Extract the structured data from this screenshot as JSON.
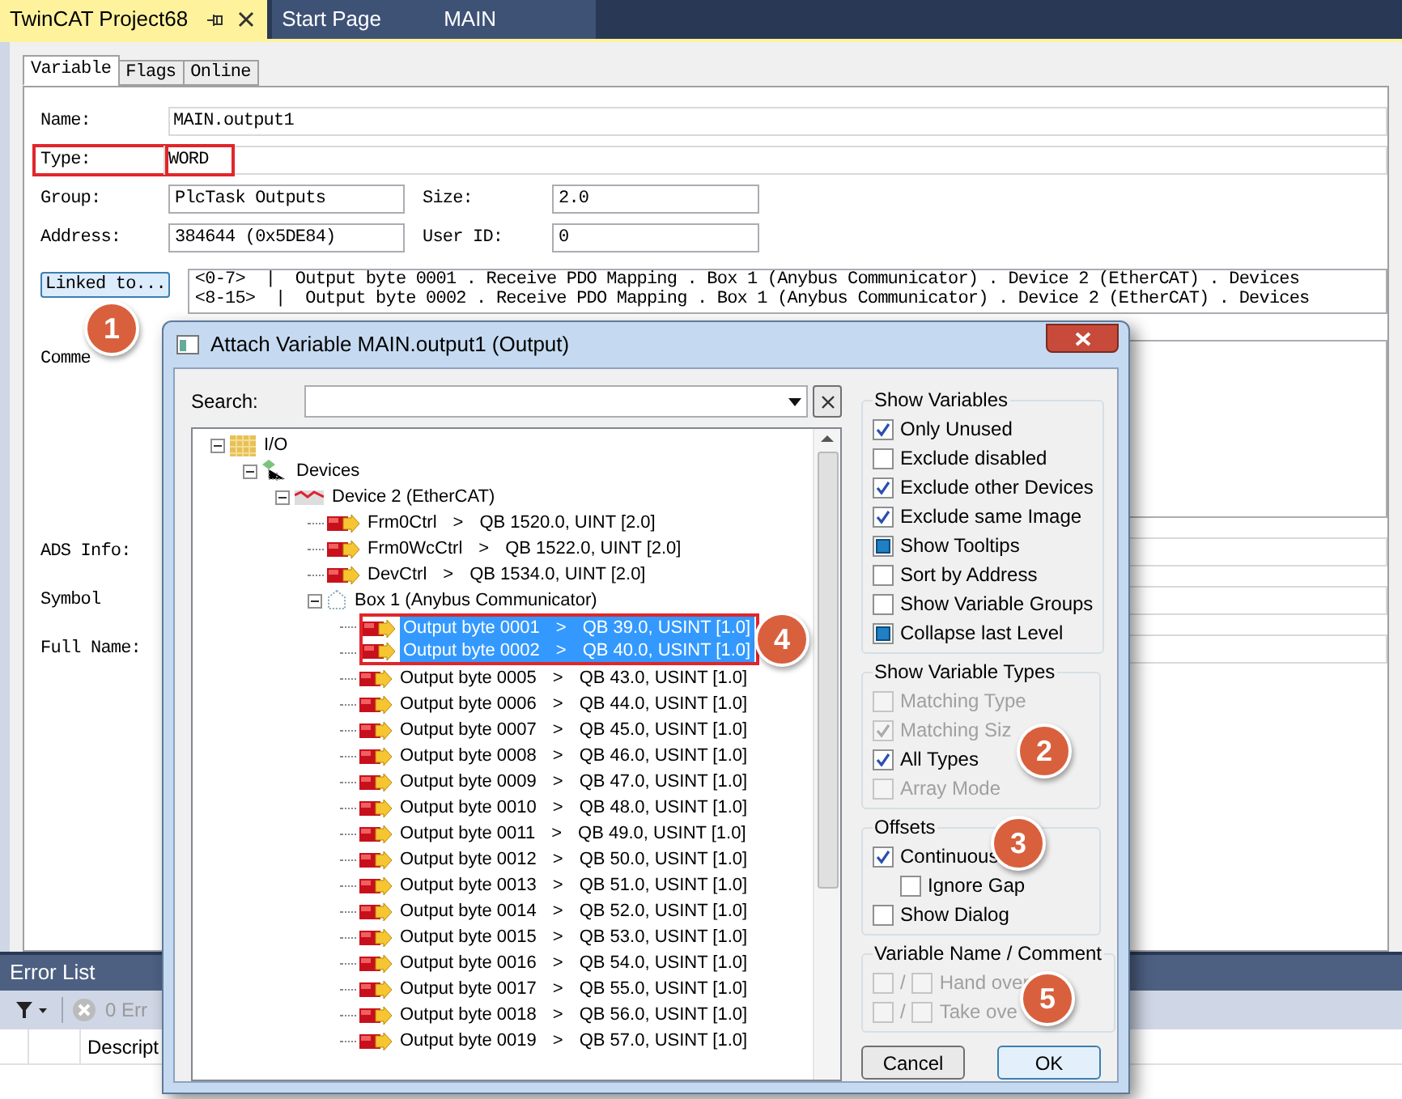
{
  "document_tabs": [
    {
      "label": "TwinCAT Project68",
      "selected": true
    },
    {
      "label": "Start Page",
      "selected": false
    },
    {
      "label": "MAIN",
      "selected": false
    }
  ],
  "property_tabs": [
    {
      "label": "Variable",
      "selected": true
    },
    {
      "label": "Flags",
      "selected": false
    },
    {
      "label": "Online",
      "selected": false
    }
  ],
  "form_rows": [
    [
      {
        "kind": "wide",
        "label": "Name:",
        "value": "MAIN.output1",
        "highlighted": false
      }
    ],
    [
      {
        "kind": "wide",
        "label": "Type:",
        "value": "WORD",
        "highlighted": true
      }
    ],
    [
      {
        "kind": "short",
        "label": "Group:",
        "value": "PlcTask Outputs",
        "highlighted": false
      },
      {
        "kind": "short",
        "label": "Size:",
        "value": "2.0",
        "highlighted": false
      }
    ],
    [
      {
        "kind": "short",
        "label": "Address:",
        "value": "384644 (0x5DE84)",
        "highlighted": false
      },
      {
        "kind": "short",
        "label": "User ID:",
        "value": "0",
        "highlighted": false
      }
    ],
    [
      {
        "kind": "link",
        "label": "Linked to...",
        "lines": [
          "<0-7>  |  Output byte 0001 . Receive PDO Mapping . Box 1 (Anybus Communicator) . Device 2 (EtherCAT) . Devices",
          "<8-15>  |  Output byte 0002 . Receive PDO Mapping . Box 1 (Anybus Communicator) . Device 2 (EtherCAT) . Devices"
        ],
        "highlighted": false
      }
    ],
    [
      {
        "kind": "area",
        "label": "Comme",
        "highlighted": false
      }
    ],
    [
      {
        "kind": "wide",
        "label": "ADS Info:",
        "highlighted": false
      }
    ],
    [
      {
        "kind": "wide",
        "label": "Symbol",
        "highlighted": false
      }
    ],
    [
      {
        "kind": "wide",
        "label": "Full Name:",
        "highlighted": false
      }
    ]
  ],
  "error_list": {
    "title": "Error List",
    "errors": "0 Err",
    "columns": [
      "Descript"
    ]
  },
  "dialog": {
    "title": "Attach Variable MAIN.output1 (Output)",
    "search_label": "Search:",
    "tree": [
      {
        "kind": "folder",
        "name": "I/O",
        "expanded": true,
        "children": [
          {
            "kind": "devices",
            "name": "Devices",
            "expanded": true,
            "children": [
              {
                "kind": "device",
                "name": "Device 2 (EtherCAT)",
                "expanded": true,
                "children": [
                  {
                    "kind": "var",
                    "name": "Frm0Ctrl",
                    "arrow": ">",
                    "address": "QB 1520.0, UINT [2.0]",
                    "selected": false,
                    "highlighted": false
                  },
                  {
                    "kind": "var",
                    "name": "Frm0WcCtrl",
                    "arrow": ">",
                    "address": "QB 1522.0, UINT [2.0]",
                    "selected": false,
                    "highlighted": false
                  },
                  {
                    "kind": "var",
                    "name": "DevCtrl",
                    "arrow": ">",
                    "address": "QB 1534.0, UINT [2.0]",
                    "selected": false,
                    "highlighted": false
                  },
                  {
                    "kind": "box",
                    "name": "Box 1 (Anybus Communicator)",
                    "expanded": true,
                    "children": [
                      {
                        "kind": "var",
                        "name": "Output byte 0001",
                        "arrow": ">",
                        "address": "QB 39.0, USINT [1.0]",
                        "selected": true,
                        "highlighted": true
                      },
                      {
                        "kind": "var",
                        "name": "Output byte 0002",
                        "arrow": ">",
                        "address": "QB 40.0, USINT [1.0]",
                        "selected": true,
                        "highlighted": true
                      },
                      {
                        "kind": "var",
                        "name": "Output byte 0005",
                        "arrow": ">",
                        "address": "QB 43.0, USINT [1.0]",
                        "selected": false,
                        "highlighted": false
                      },
                      {
                        "kind": "var",
                        "name": "Output byte 0006",
                        "arrow": ">",
                        "address": "QB 44.0, USINT [1.0]",
                        "selected": false,
                        "highlighted": false
                      },
                      {
                        "kind": "var",
                        "name": "Output byte 0007",
                        "arrow": ">",
                        "address": "QB 45.0, USINT [1.0]",
                        "selected": false,
                        "highlighted": false
                      },
                      {
                        "kind": "var",
                        "name": "Output byte 0008",
                        "arrow": ">",
                        "address": "QB 46.0, USINT [1.0]",
                        "selected": false,
                        "highlighted": false
                      },
                      {
                        "kind": "var",
                        "name": "Output byte 0009",
                        "arrow": ">",
                        "address": "QB 47.0, USINT [1.0]",
                        "selected": false,
                        "highlighted": false
                      },
                      {
                        "kind": "var",
                        "name": "Output byte 0010",
                        "arrow": ">",
                        "address": "QB 48.0, USINT [1.0]",
                        "selected": false,
                        "highlighted": false
                      },
                      {
                        "kind": "var",
                        "name": "Output byte 0011",
                        "arrow": ">",
                        "address": "QB 49.0, USINT [1.0]",
                        "selected": false,
                        "highlighted": false
                      },
                      {
                        "kind": "var",
                        "name": "Output byte 0012",
                        "arrow": ">",
                        "address": "QB 50.0, USINT [1.0]",
                        "selected": false,
                        "highlighted": false
                      },
                      {
                        "kind": "var",
                        "name": "Output byte 0013",
                        "arrow": ">",
                        "address": "QB 51.0, USINT [1.0]",
                        "selected": false,
                        "highlighted": false
                      },
                      {
                        "kind": "var",
                        "name": "Output byte 0014",
                        "arrow": ">",
                        "address": "QB 52.0, USINT [1.0]",
                        "selected": false,
                        "highlighted": false
                      },
                      {
                        "kind": "var",
                        "name": "Output byte 0015",
                        "arrow": ">",
                        "address": "QB 53.0, USINT [1.0]",
                        "selected": false,
                        "highlighted": false
                      },
                      {
                        "kind": "var",
                        "name": "Output byte 0016",
                        "arrow": ">",
                        "address": "QB 54.0, USINT [1.0]",
                        "selected": false,
                        "highlighted": false
                      },
                      {
                        "kind": "var",
                        "name": "Output byte 0017",
                        "arrow": ">",
                        "address": "QB 55.0, USINT [1.0]",
                        "selected": false,
                        "highlighted": false
                      },
                      {
                        "kind": "var",
                        "name": "Output byte 0018",
                        "arrow": ">",
                        "address": "QB 56.0, USINT [1.0]",
                        "selected": false,
                        "highlighted": false
                      },
                      {
                        "kind": "var",
                        "name": "Output byte 0019",
                        "arrow": ">",
                        "address": "QB 57.0, USINT [1.0]",
                        "selected": false,
                        "highlighted": false
                      }
                    ]
                  }
                ]
              }
            ]
          }
        ]
      }
    ],
    "groups": [
      {
        "title": "Show Variables",
        "items": [
          {
            "kind": "check",
            "label": "Only Unused",
            "checked": true,
            "disabled": false
          },
          {
            "kind": "check",
            "label": "Exclude disabled",
            "checked": false,
            "disabled": false
          },
          {
            "kind": "check",
            "label": "Exclude other Devices",
            "checked": true,
            "disabled": false
          },
          {
            "kind": "check",
            "label": "Exclude same Image",
            "checked": true,
            "disabled": false
          },
          {
            "kind": "fill",
            "label": "Show Tooltips",
            "checked": true,
            "disabled": false
          },
          {
            "kind": "check",
            "label": "Sort by Address",
            "checked": false,
            "disabled": false
          },
          {
            "kind": "check",
            "label": "Show Variable Groups",
            "checked": false,
            "disabled": false
          },
          {
            "kind": "fill",
            "label": "Collapse last Level",
            "checked": true,
            "disabled": false
          }
        ]
      },
      {
        "title": "Show Variable Types",
        "items": [
          {
            "kind": "check",
            "label": "Matching Type",
            "checked": false,
            "disabled": true
          },
          {
            "kind": "check",
            "label": "Matching Siz",
            "checked": true,
            "disabled": true
          },
          {
            "kind": "check",
            "label": "All Types",
            "checked": true,
            "disabled": false
          },
          {
            "kind": "check",
            "label": "Array Mode",
            "checked": false,
            "disabled": true
          }
        ]
      },
      {
        "title": "Offsets",
        "items": [
          {
            "kind": "check",
            "label": "Continuous",
            "checked": true,
            "disabled": false
          },
          {
            "kind": "subcheck",
            "label": "Ignore Gap",
            "checked": false,
            "disabled": false
          },
          {
            "kind": "check",
            "label": "Show Dialog",
            "checked": false,
            "disabled": false
          }
        ]
      },
      {
        "title": "Variable Name / Comment",
        "items": [
          {
            "kind": "pair",
            "separator": "/",
            "label": "Hand over",
            "checked": false,
            "checked_second": false,
            "disabled": true
          },
          {
            "kind": "pair",
            "separator": "/",
            "label": "Take ove",
            "checked": false,
            "checked_second": false,
            "disabled": true
          }
        ]
      }
    ],
    "buttons": [
      {
        "label": "Cancel",
        "default": false
      },
      {
        "label": "OK",
        "default": true
      }
    ]
  },
  "callouts": [
    "1",
    "2",
    "3",
    "4",
    "5"
  ]
}
